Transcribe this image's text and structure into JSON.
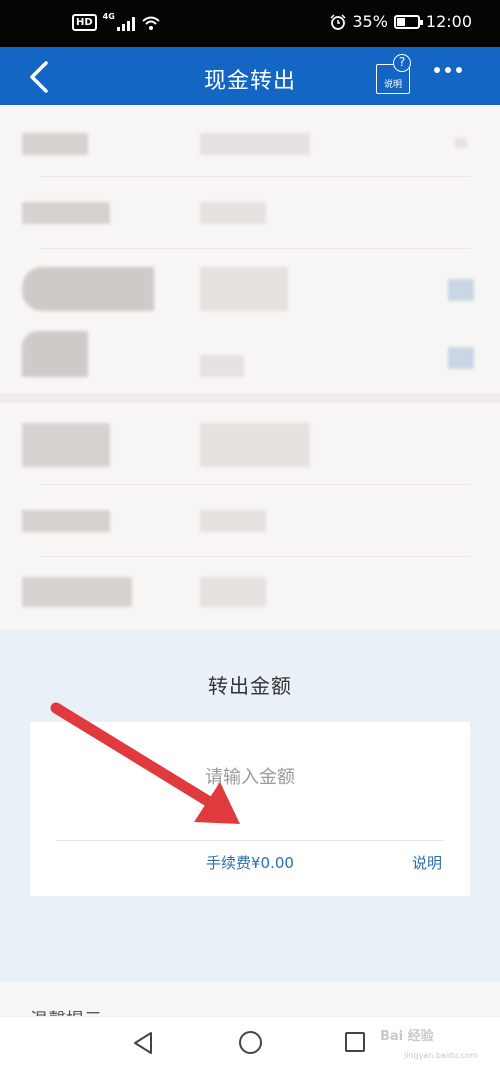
{
  "status_bar": {
    "hd": "HD",
    "network": "4G",
    "battery_percent": "35%",
    "time": "12:00",
    "battery_level": 0.35
  },
  "nav": {
    "title": "现金转出",
    "help_label": "说明",
    "help_symbol": "?"
  },
  "amount": {
    "title": "转出金额",
    "input_placeholder": "请输入金额",
    "input_value": "",
    "fee": "手续费¥0.00",
    "fee_explain": "说明"
  },
  "tip": {
    "partial_text": "温馨提示"
  },
  "watermark": {
    "text": "Bai 经验",
    "url": "jingyan.baidu.com"
  },
  "colors": {
    "nav_bg": "#1366c4",
    "section_bg": "#eaf0f8",
    "link": "#2a6fb0",
    "annotation_arrow": "#e03a3e"
  }
}
